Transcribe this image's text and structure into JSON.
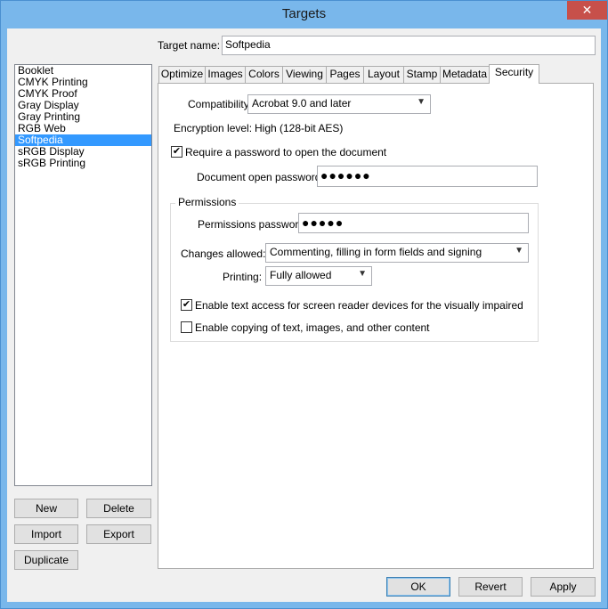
{
  "window": {
    "title": "Targets",
    "close_glyph": "✕"
  },
  "target_name": {
    "label": "Target name:",
    "value": "Softpedia"
  },
  "targets": [
    "Booklet",
    "CMYK Printing",
    "CMYK Proof",
    "Gray Display",
    "Gray Printing",
    "RGB Web",
    "Softpedia",
    "sRGB Display",
    "sRGB Printing"
  ],
  "selected_target": "Softpedia",
  "list_buttons": {
    "new": "New",
    "delete": "Delete",
    "import": "Import",
    "export": "Export",
    "duplicate": "Duplicate"
  },
  "tabs": [
    "Optimize",
    "Images",
    "Colors",
    "Viewing",
    "Pages",
    "Layout",
    "Stamp",
    "Metadata",
    "Security"
  ],
  "active_tab": "Security",
  "security": {
    "compatibility_label": "Compatibility:",
    "compatibility_value": "Acrobat 9.0 and later",
    "encryption_label": "Encryption level:",
    "encryption_value": "High (128-bit AES)",
    "require_password_label": "Require a password to open the document",
    "require_password_checked": true,
    "open_password_label": "Document open password:",
    "open_password_value": "●●●●●●",
    "permissions": {
      "title": "Permissions",
      "password_label": "Permissions password:",
      "password_value": "●●●●●",
      "changes_label": "Changes allowed:",
      "changes_value": "Commenting, filling in form fields and signing",
      "printing_label": "Printing:",
      "printing_value": "Fully allowed",
      "screen_reader_label": "Enable text access for screen reader devices for the visually impaired",
      "screen_reader_checked": true,
      "copying_label": "Enable copying of text, images, and other content",
      "copying_checked": false
    }
  },
  "footer_buttons": {
    "ok": "OK",
    "revert": "Revert",
    "apply": "Apply"
  },
  "icons": {
    "checkmark": "✔",
    "dropdown_arrow": "▼"
  }
}
